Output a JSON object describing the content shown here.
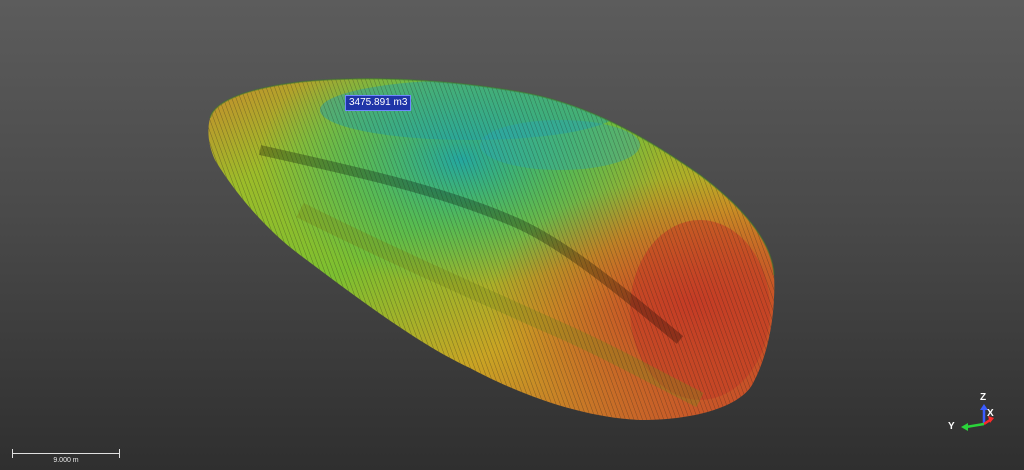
{
  "viewer": {
    "background_top": "#5c5c5c",
    "background_bottom": "#2f2f2f"
  },
  "point_cloud": {
    "description_colors": [
      "#1fa6a0",
      "#3cb84a",
      "#9cc428",
      "#c8a020",
      "#c8542a"
    ],
    "volume_label": "3475.891 m3"
  },
  "scale_bar": {
    "label": "9.000 m"
  },
  "axis_gizmo": {
    "z_label": "Z",
    "x_label": "X",
    "y_label": "Y",
    "z_color": "#3a5cff",
    "x_color": "#ff2a2a",
    "y_color": "#2ad43a"
  }
}
